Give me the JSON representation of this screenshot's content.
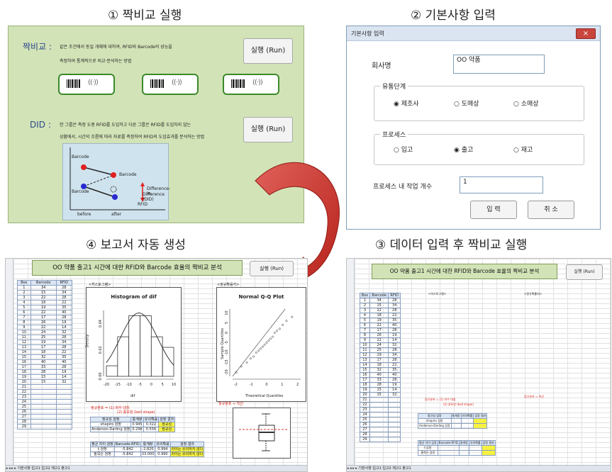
{
  "sections": {
    "s1": "① 짝비교 실행",
    "s2": "② 기본사항 입력",
    "s3": "③ 데이터 입력 후 짝비교 실행",
    "s4": "④ 보고서 자동 생성"
  },
  "panel1": {
    "pair_label": "짝비교 :",
    "pair_line1": "같은 조건에서 동일 개체에 대하여, RFID와 Barcode의 성능을",
    "pair_line2": "측정하여 통계적으로 비교·분석하는 방법",
    "run_label": "실행 (Run)",
    "did_label": "DID :",
    "did_line1": "한 그룹은 측정 도중 RFID를 도입하고 다른 그룹은 RFID를 도입하지 않는",
    "did_line2": "상황에서, 시간의 흐름에 따라 자료를 측정하여 RFID의 도입효과를 분석하는 방법",
    "did_run_label": "실행 (Run)",
    "tag_rfid": "((·))",
    "did_fig": {
      "barcode_top": "Barcode",
      "barcode_right": "Barcode",
      "barcode_left": "Barcode",
      "did_text1": "Difference-in-",
      "did_text2": "Difference (DID)",
      "rfid": "RFID",
      "before": "before",
      "after": "after"
    }
  },
  "dialog": {
    "title": "기본사항 입력",
    "close": "×",
    "company_label": "회사명",
    "company_value": "OO 약품",
    "stage_legend": "유통단계",
    "stage_options": [
      "제조사",
      "도매상",
      "소매상"
    ],
    "stage_selected": "제조사",
    "process_legend": "프로세스",
    "process_options": [
      "입고",
      "출고",
      "재고"
    ],
    "process_selected": "출고",
    "count_label": "프로세스 내 작업 개수",
    "count_value": "1",
    "ok": "입 력",
    "cancel": "취 소"
  },
  "report": {
    "title": "OO 약품 출고1 시간에 대한 RFID와 Barcode 효율의 짝비교 분석",
    "run_label": "실행 (Run)",
    "col_headers": [
      "Box",
      "Barcode",
      "RFID"
    ],
    "rows": [
      [
        1,
        34,
        28
      ],
      [
        2,
        15,
        34
      ],
      [
        3,
        22,
        28
      ],
      [
        4,
        18,
        22
      ],
      [
        5,
        19,
        35
      ],
      [
        6,
        22,
        40
      ],
      [
        7,
        17,
        28
      ],
      [
        8,
        26,
        19
      ],
      [
        9,
        22,
        14
      ],
      [
        10,
        24,
        32
      ],
      [
        11,
        25,
        28
      ],
      [
        12,
        19,
        34
      ],
      [
        13,
        17,
        28
      ],
      [
        14,
        18,
        22
      ],
      [
        15,
        32,
        35
      ],
      [
        16,
        40,
        40
      ],
      [
        17,
        33,
        28
      ],
      [
        18,
        28,
        19
      ],
      [
        19,
        15,
        14
      ],
      [
        20,
        15,
        32
      ],
      [
        21,
        "",
        ""
      ],
      [
        22,
        "",
        ""
      ],
      [
        23,
        "",
        ""
      ],
      [
        24,
        "",
        ""
      ],
      [
        25,
        "",
        ""
      ],
      [
        26,
        "",
        ""
      ],
      [
        27,
        "",
        ""
      ],
      [
        28,
        "",
        ""
      ],
      [
        29,
        "",
        ""
      ]
    ],
    "hist_label": "<히스토그램>",
    "qq_label": "<정규확률지>",
    "hist_title": "Histogram of dif",
    "hist_xlabel": "dif",
    "hist_ylabel": "Density",
    "qq_title": "Normal Q-Q Plot",
    "qq_xlabel": "Theoretical Quantiles",
    "qq_ylabel": "Sample Quantiles",
    "normal_note1": "정규분포 =  (1) 좌우 대칭",
    "normal_note2": "(2) 종모양 (bell shape)",
    "normal_note3": "정규분포 ≈ 직선",
    "norm_test_headers": [
      "정규성 검정",
      "통계량",
      "유의확률",
      "검정 결과"
    ],
    "norm_tests": [
      [
        "shapiro 검정",
        "0.945",
        "0.322",
        "정규성"
      ],
      [
        "Anderson-Darling 검정",
        "0.296",
        "0.556",
        "정규성"
      ]
    ],
    "mean_test_headers": [
      "평균 차이 검정",
      "Barcode-RFID",
      "통계량",
      "유의확률",
      "검정 결과"
    ],
    "mean_tests": [
      [
        "t 검정",
        "-5.842",
        "-2.820",
        "0.994",
        "차이는 유의하지 않다"
      ],
      [
        "윌콕슨 검정",
        "-5.842",
        "33.000",
        "0.990",
        "차이는 유의하지 않다"
      ]
    ],
    "sheet_tabs": "◂ ◂ ▸ ▸  기본사항  입고1  입고2  재고1  출고1"
  },
  "chart_data": [
    {
      "type": "bar",
      "title": "Histogram of dif",
      "xlabel": "dif",
      "ylabel": "Density",
      "categories": [
        "-20",
        "-15",
        "-10",
        "-5",
        "0",
        "5"
      ],
      "values": [
        0.008,
        0.03,
        0.046,
        0.046,
        0.03,
        0.022
      ],
      "x_ticks": [
        "-20",
        "-15",
        "-10",
        "-5",
        "0",
        "5",
        "10"
      ],
      "y_ticks": [
        "0.00",
        "0.02",
        "0.04"
      ],
      "ylim": [
        0,
        0.05
      ]
    },
    {
      "type": "scatter",
      "title": "Normal Q-Q Plot",
      "xlabel": "Theoretical Quantiles",
      "ylabel": "Sample Quantiles",
      "x": [
        -1.96,
        -1.64,
        -1.28,
        -1.04,
        -0.84,
        -0.67,
        -0.52,
        -0.39,
        -0.25,
        -0.13,
        0,
        0.13,
        0.25,
        0.39,
        0.52,
        0.67,
        0.84,
        1.04,
        1.28,
        1.64
      ],
      "y": [
        -20,
        -17,
        -15,
        -13,
        -12,
        -10,
        -9,
        -8,
        -7,
        -6,
        -5,
        -4,
        -3,
        -2,
        0,
        1,
        2,
        4,
        6,
        8
      ],
      "x_ticks": [
        "-2",
        "-1",
        "0",
        "1",
        "2"
      ],
      "y_ticks": [
        "-20",
        "-15",
        "-10",
        "-5",
        "0",
        "5",
        "10"
      ]
    }
  ]
}
